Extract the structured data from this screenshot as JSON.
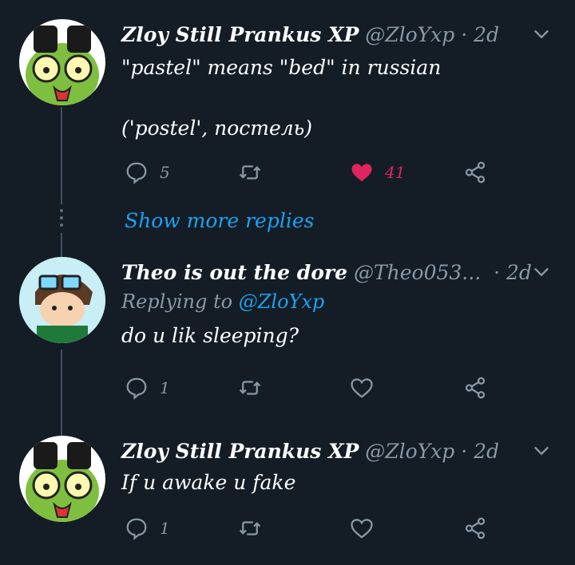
{
  "tweets": [
    {
      "name": "Zloy Still Prankus XP",
      "handle": "@ZloYxp",
      "time": "· 2d",
      "lines": [
        "\"pastel\" means \"bed\" in russian",
        "",
        "('postel', постель)"
      ],
      "replies": "5",
      "retweets": "",
      "likes": "41",
      "liked": true
    },
    {
      "name": "Theo is out the dore",
      "handle": "@Theo053...",
      "time": "· 2d",
      "replying_label": "Replying to",
      "replying_to": "@ZloYxp",
      "lines": [
        "do u lik sleeping?"
      ],
      "replies": "1",
      "retweets": "",
      "likes": "",
      "liked": false
    },
    {
      "name": "Zloy Still Prankus XP",
      "handle": "@ZloYxp",
      "time": "· 2d",
      "lines": [
        "If u awake u fake"
      ],
      "replies": "1",
      "retweets": "",
      "likes": "",
      "liked": false
    }
  ],
  "show_more_replies": "Show more replies",
  "colors": {
    "background": "#141d26",
    "accent": "#1da1f2",
    "like": "#e0245e",
    "muted": "#8899a6"
  }
}
